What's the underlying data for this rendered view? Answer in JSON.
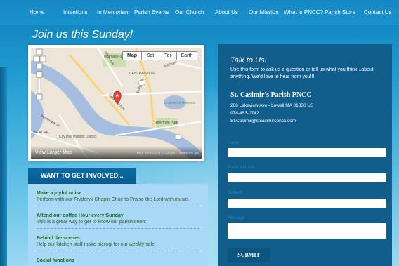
{
  "nav": {
    "items": [
      "Home",
      "Intentions",
      "In Memoriam",
      "Parish Events",
      "Our Church",
      "About Us",
      "Our Mission",
      "What is PNCC?",
      "Parish Store",
      "Contact Us"
    ]
  },
  "hero": {
    "title": "Join us this Sunday!"
  },
  "map": {
    "types": [
      "Map",
      "Sat",
      "Ter",
      "Earth"
    ],
    "view_larger": "View Larger Map",
    "copyright": "Map data ©2013 Google · Terms of Use",
    "marker": "A",
    "labels": [
      "McPhail Playground",
      "CENTRALVILLE",
      "Aiken Ave",
      "Lakeview Ave",
      "Bridge St",
      "Chiknok Hill Reservoir",
      "Riverfront Park",
      "Merrimack St",
      "City Hall Historic District",
      "THE ACRE",
      "Methuen"
    ]
  },
  "involved": {
    "heading": "WANT TO GET INVOLVED...",
    "items": [
      {
        "title": "Make a joyful noise",
        "desc": "Perform with our Fryderyk Chopin Choir to Praise the Lord with music."
      },
      {
        "title": "Attend our coffee Hour every Sunday",
        "desc": "This is a great way to get to know our parishioners"
      },
      {
        "title": "Behind the scenes",
        "desc": "Help our kitchen staff make pierogi for our weekly sale"
      },
      {
        "title": "Social functions",
        "desc": ""
      }
    ]
  },
  "contact": {
    "heading": "Talk to Us!",
    "description": "Use this form to ask us a question or tell us what you think...about anything.  We'd love to hear from you!!!",
    "parish_name": "St. Casimir's Parish PNCC",
    "address": "268 Lakeview Ave - Lowell MA 01850 US",
    "phone": "978-453-0742",
    "email": "St.Casimir@stcasimirspncc.com",
    "fields": {
      "name_label": "Name",
      "email_label": "Email address",
      "subject_label": "Subject",
      "message_label": "Message"
    },
    "submit_label": "SUBMIT"
  },
  "colors": {
    "nav_bg": "#1688c4",
    "panel_bg": "#115e8c",
    "involved_bg": "#a9d8f6",
    "accent_green": "#1c6b1c"
  }
}
